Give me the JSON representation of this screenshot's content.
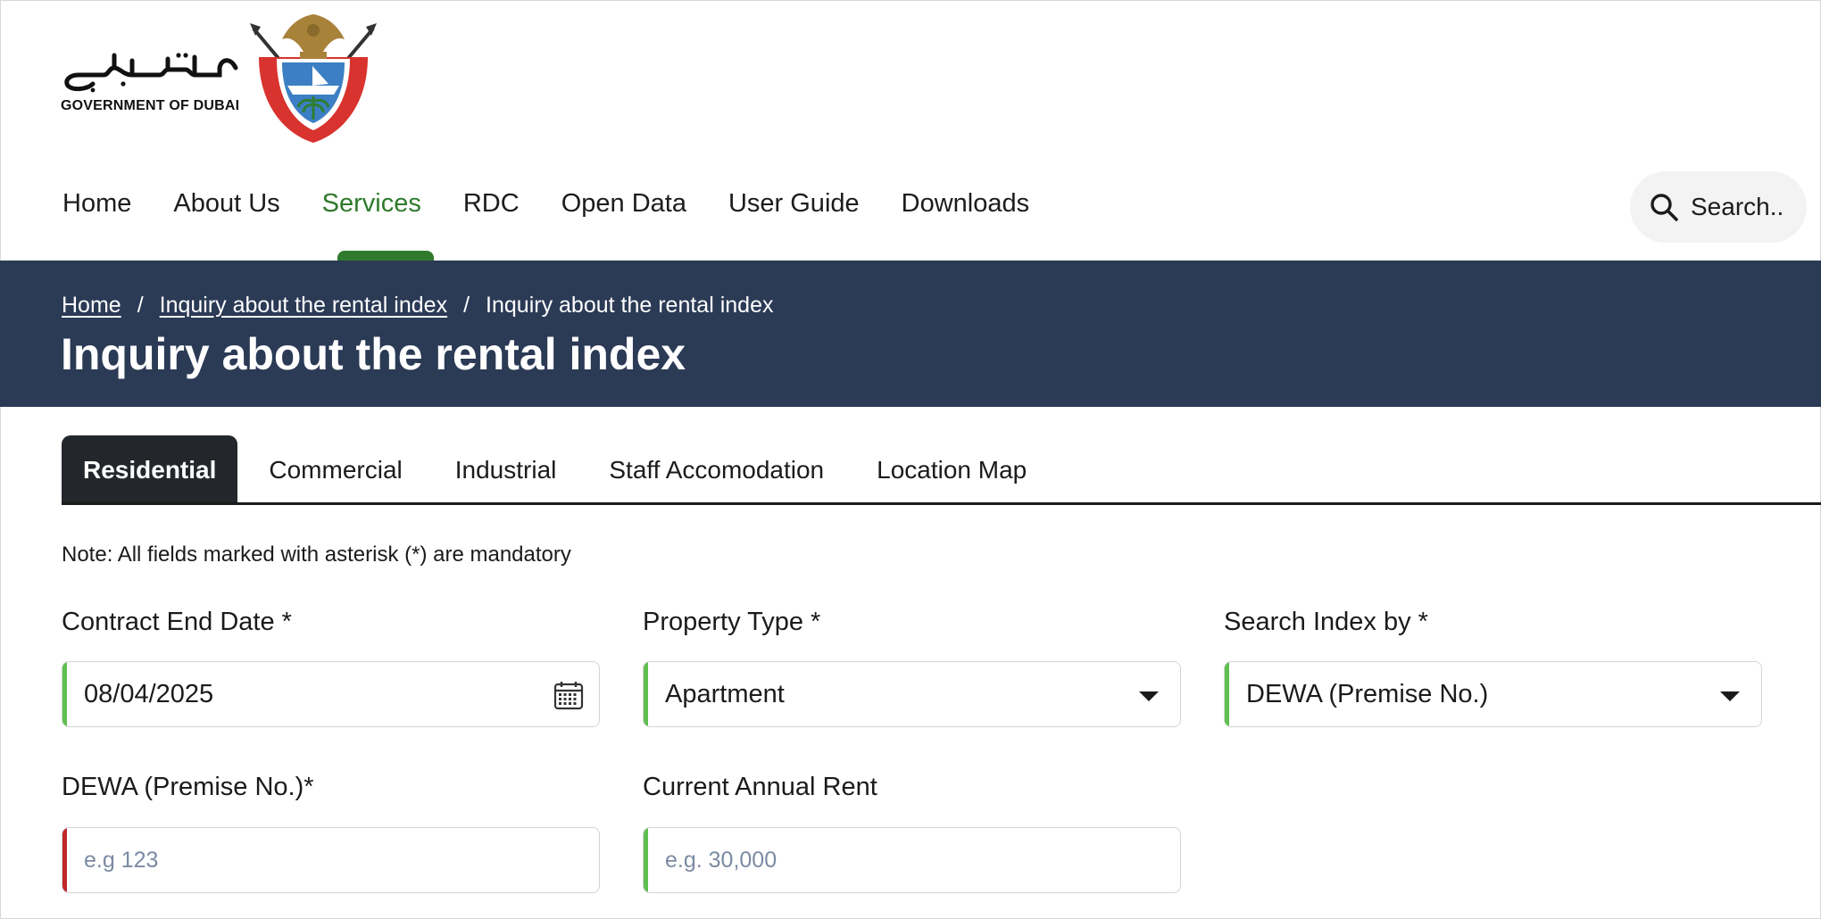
{
  "logo": {
    "arabic": "حكومـــة دبــــي",
    "english": "GOVERNMENT OF DUBAI"
  },
  "nav": {
    "items": [
      "Home",
      "About Us",
      "Services",
      "RDC",
      "Open Data",
      "User Guide",
      "Downloads"
    ],
    "active": "Services",
    "search_label": "Search.."
  },
  "breadcrumb": {
    "items": [
      "Home",
      "Inquiry about the rental index",
      "Inquiry about the rental index"
    ],
    "separator": "/"
  },
  "page_title": "Inquiry about the rental index",
  "tabs": {
    "items": [
      "Residential",
      "Commercial",
      "Industrial",
      "Staff Accomodation",
      "Location Map"
    ],
    "active": "Residential"
  },
  "note": "Note: All fields marked with asterisk (*) are mandatory",
  "form": {
    "contract_end_date": {
      "label": "Contract End Date *",
      "value": "08/04/2025"
    },
    "property_type": {
      "label": "Property Type *",
      "value": "Apartment"
    },
    "search_index_by": {
      "label": "Search Index by *",
      "value": "DEWA (Premise No.)"
    },
    "dewa_premise": {
      "label": "DEWA (Premise No.)*",
      "placeholder": "e.g 123"
    },
    "current_annual_rent": {
      "label": "Current Annual Rent",
      "placeholder": "e.g. 30,000"
    }
  },
  "colors": {
    "banner": "#2b3a55",
    "active_nav": "#2f7a2c",
    "active_tab": "#23272b",
    "field_accent_valid": "#5fbf4f",
    "field_accent_error": "#c0282a"
  }
}
